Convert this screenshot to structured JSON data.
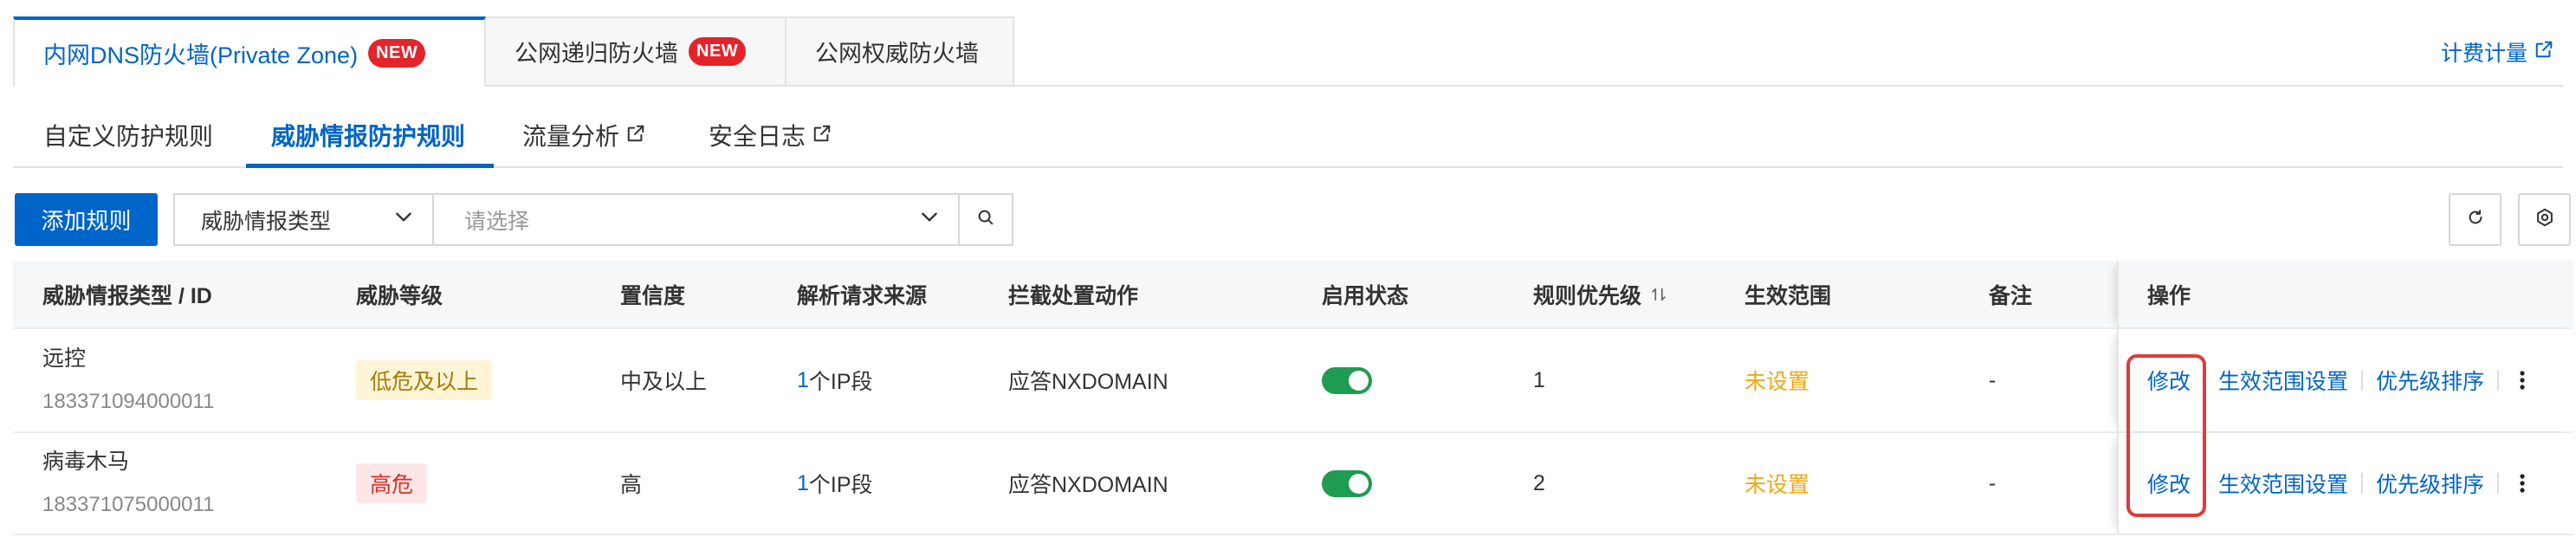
{
  "product_tabs": [
    {
      "label": "内网DNS防火墙(Private Zone)",
      "badge": "NEW",
      "active": true
    },
    {
      "label": "公网递归防火墙",
      "badge": "NEW",
      "active": false
    },
    {
      "label": "公网权威防火墙",
      "active": false
    }
  ],
  "billing_link": {
    "label": "计费计量",
    "icon": "external-link-icon"
  },
  "sub_tabs": [
    {
      "label": "自定义防护规则",
      "active": false
    },
    {
      "label": "威胁情报防护规则",
      "active": true
    },
    {
      "label": "流量分析",
      "active": false,
      "icon": "external-link-icon"
    },
    {
      "label": "安全日志",
      "active": false,
      "icon": "external-link-icon"
    }
  ],
  "toolbar": {
    "add_rule_label": "添加规则",
    "filter_field": {
      "value": "威胁情报类型",
      "icon": "chevron-down-icon"
    },
    "filter_value": {
      "placeholder": "请选择",
      "icon": "chevron-down-icon"
    },
    "search_icon": "search-icon",
    "refresh_icon": "refresh-icon",
    "settings_icon": "gear-icon"
  },
  "table": {
    "columns": {
      "type_id": "威胁情报类型 / ID",
      "level": "威胁等级",
      "confidence": "置信度",
      "source": "解析请求来源",
      "action": "拦截处置动作",
      "status": "启用状态",
      "priority": "规则优先级",
      "scope": "生效范围",
      "remark": "备注",
      "ops": "操作"
    },
    "priority_sort_icon": "sort-icon",
    "rows": [
      {
        "name": "远控",
        "id": "183371094000011",
        "level": {
          "label": "低危及以上",
          "bg": "#fff4d6",
          "fg": "#a67c00"
        },
        "confidence": "中及以上",
        "source": {
          "count": "1",
          "unit": "个IP段"
        },
        "action": "应答NXDOMAIN",
        "enabled": true,
        "priority": "1",
        "scope": "未设置",
        "remark": "-",
        "ops": {
          "edit": "修改",
          "scope": "生效范围设置",
          "order": "优先级排序",
          "more_icon": "more-vertical-icon"
        }
      },
      {
        "name": "病毒木马",
        "id": "183371075000011",
        "level": {
          "label": "高危",
          "bg": "#fde7e6",
          "fg": "#d93026"
        },
        "confidence": "高",
        "source": {
          "count": "1",
          "unit": "个IP段"
        },
        "action": "应答NXDOMAIN",
        "enabled": true,
        "priority": "2",
        "scope": "未设置",
        "remark": "-",
        "ops": {
          "edit": "修改",
          "scope": "生效范围设置",
          "order": "优先级排序",
          "more_icon": "more-vertical-icon"
        }
      }
    ]
  },
  "colors": {
    "primary": "#0064c8",
    "badge_new": "#e3242b",
    "toggle_on": "#1e9c52",
    "scope_unset": "#eda812",
    "highlight": "#e23a3a",
    "text": "#333333",
    "muted": "#888888"
  }
}
